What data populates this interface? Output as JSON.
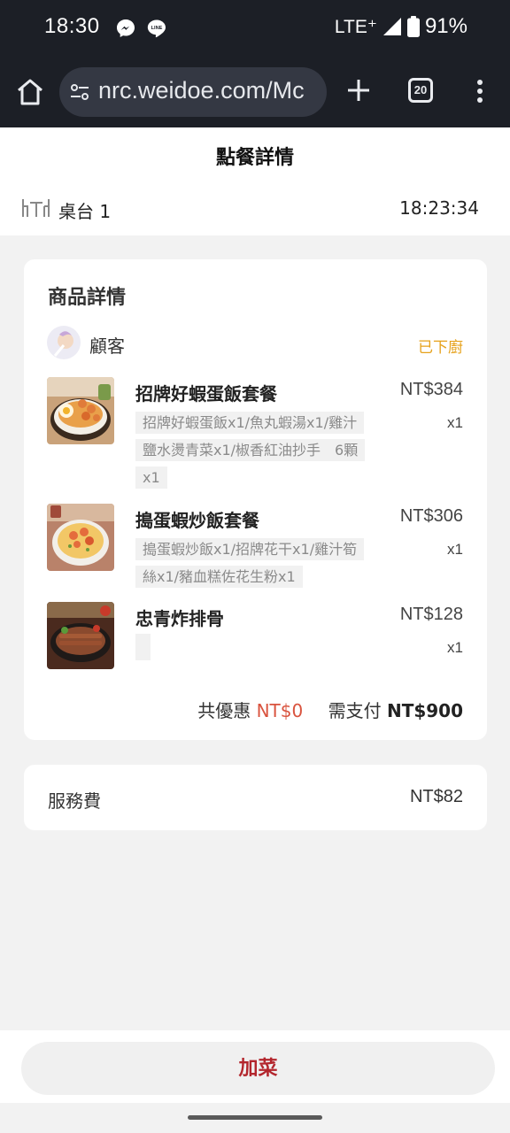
{
  "status_bar": {
    "time": "18:30",
    "network": "LTE⁺",
    "battery": "91%",
    "icons": [
      "messenger-icon",
      "line-icon",
      "signal-icon",
      "battery-icon"
    ]
  },
  "browser": {
    "url": "nrc.weidoe.com/Mc",
    "tab_count": "20",
    "icons": [
      "home-icon",
      "site-settings-icon",
      "plus-icon",
      "tabs-icon",
      "more-vert-icon"
    ]
  },
  "page": {
    "title": "點餐詳情",
    "table": "桌台 1",
    "time": "18:23:34"
  },
  "products": {
    "title": "商品詳情",
    "customer": "顧客",
    "status": "已下廚",
    "items": [
      {
        "name": "招牌好蝦蛋飯套餐",
        "price": "NT$384",
        "qty": "x1",
        "desc_lines": [
          "招牌好蝦蛋飯x1/魚丸蝦湯x1/雞汁",
          "鹽水燙青菜x1/椒香紅油抄手　6顆",
          "x1"
        ]
      },
      {
        "name": "搗蛋蝦炒飯套餐",
        "price": "NT$306",
        "qty": "x1",
        "desc_lines": [
          "搗蛋蝦炒飯x1/招牌花干x1/雞汁筍",
          "絲x1/豬血糕佐花生粉x1"
        ]
      },
      {
        "name": "忠青炸排骨",
        "price": "NT$128",
        "qty": "x1",
        "desc_lines": []
      }
    ],
    "discount_label": "共優惠",
    "discount_value": "NT$0",
    "total_label": "需支付",
    "total_value": "NT$900"
  },
  "service_fee": {
    "label": "服務費",
    "value": "NT$82"
  },
  "add_button": "加菜",
  "colors": {
    "status_bar_bg": "#1c1f26",
    "status_orange": "#e6a11a",
    "discount_red": "#d9533e",
    "add_button_text": "#b3262d"
  }
}
